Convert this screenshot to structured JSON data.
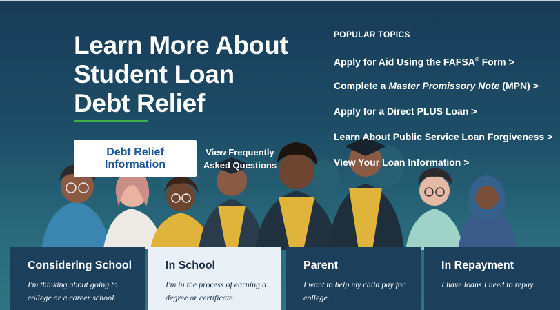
{
  "hero": {
    "title": "Learn More About Student Loan Debt Relief",
    "primary_button_label": "Debt Relief Information",
    "faq_link_label": "View Frequently Asked Questions"
  },
  "popular_topics": {
    "heading": "POPULAR TOPICS",
    "links": [
      {
        "pre": "Apply for Aid Using the FAFSA",
        "sup": "®",
        "post": " Form >"
      },
      {
        "pre": "Complete a ",
        "em": "Master Promissory Note",
        "post": " (MPN) >"
      },
      {
        "pre": "Apply for a Direct PLUS Loan >"
      },
      {
        "pre": "Learn About Public Service Loan Forgiveness >"
      },
      {
        "pre": "View Your Loan Information >"
      }
    ]
  },
  "persona_cards": [
    {
      "title": "Considering School",
      "description": "I'm thinking about going to college or a career school.",
      "selected": false
    },
    {
      "title": "In School",
      "description": "I'm in the process of earning a degree or certificate.",
      "selected": true
    },
    {
      "title": "Parent",
      "description": "I want to help my child pay for college.",
      "selected": false
    },
    {
      "title": "In Repayment",
      "description": "I have loans I need to repay.",
      "selected": false
    }
  ],
  "colors": {
    "hero_background": "#1e4f68",
    "card_background": "#1c3f5c",
    "card_selected_background": "#e9f1f7",
    "accent_rule": "#3fae49",
    "button_text": "#20579c"
  },
  "illustration": {
    "name": "graduates-group-illustration"
  }
}
